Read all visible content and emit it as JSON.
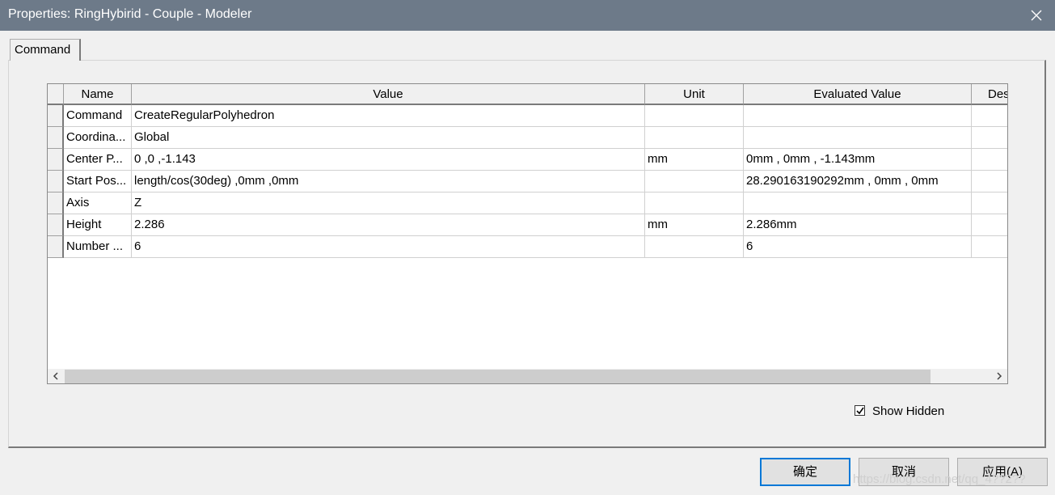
{
  "window": {
    "title": "Properties: RingHybirid - Couple - Modeler"
  },
  "tabs": [
    {
      "label": "Command"
    }
  ],
  "table": {
    "columns": [
      "Name",
      "Value",
      "Unit",
      "Evaluated Value",
      "Des"
    ],
    "rows": [
      [
        "Command",
        "CreateRegularPolyhedron",
        "",
        ""
      ],
      [
        "Coordina...",
        "Global",
        "",
        ""
      ],
      [
        "Center P...",
        "0 ,0 ,-1.143",
        "mm",
        "0mm , 0mm , -1.143mm"
      ],
      [
        "Start Pos...",
        "length/cos(30deg) ,0mm ,0mm",
        "",
        "28.290163190292mm , 0mm , 0mm"
      ],
      [
        "Axis",
        "Z",
        "",
        ""
      ],
      [
        "Height",
        "2.286",
        "mm",
        "2.286mm"
      ],
      [
        "Number ...",
        "6",
        "",
        "6"
      ]
    ]
  },
  "show_hidden": {
    "label": "Show Hidden",
    "checked": true
  },
  "buttons": {
    "ok": "确定",
    "cancel": "取消",
    "apply": "应用(A)"
  },
  "watermark": "https://blog.csdn.net/qq_4??2??"
}
